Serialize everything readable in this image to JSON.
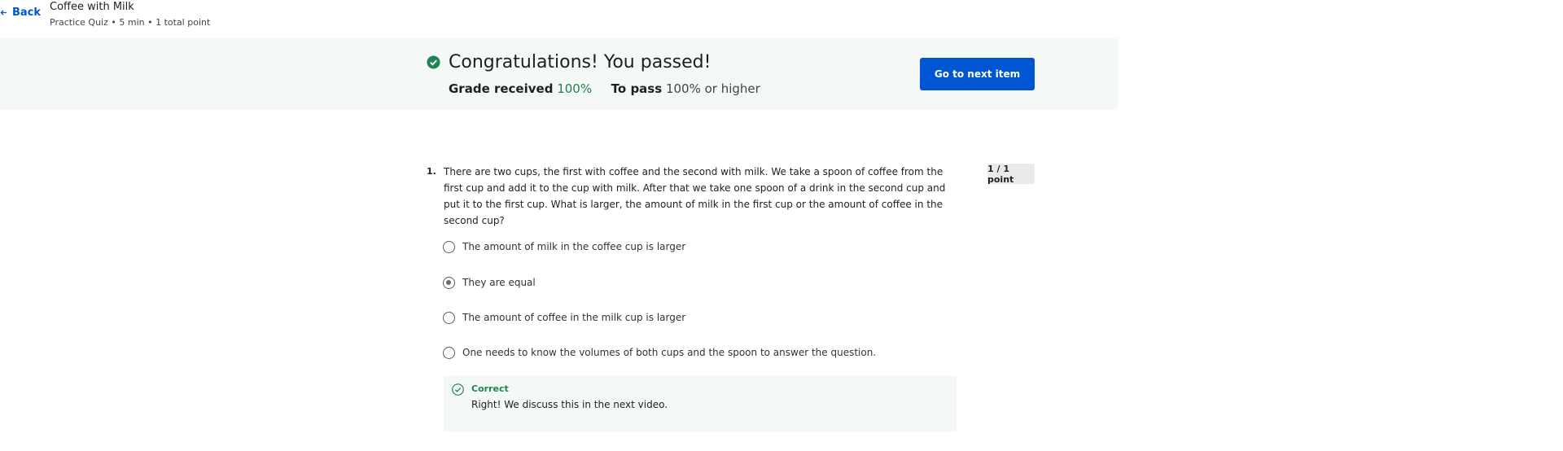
{
  "header": {
    "back_label": "Back",
    "title": "Coffee with Milk",
    "subtitle": "Practice Quiz • 5 min • 1 total point"
  },
  "banner": {
    "headline": "Congratulations! You passed!",
    "grade_label": "Grade received",
    "grade_value": "100%",
    "pass_label": "To pass",
    "pass_value": "100% or higher",
    "next_button": "Go to next item"
  },
  "question": {
    "number": "1.",
    "text": "There are two cups, the first with coffee and the second with milk. We take a spoon of coffee from the first cup and add it to the cup with milk. After that we take one spoon of a drink in the second cup and put it to the first cup. What is larger, the amount of milk in the first cup or the amount of coffee in the second cup?",
    "points": "1 / 1 point",
    "options": [
      {
        "label": "The amount of milk in the coffee cup is larger",
        "selected": false
      },
      {
        "label": "They are equal",
        "selected": true
      },
      {
        "label": "The amount of coffee in the milk cup is larger",
        "selected": false
      },
      {
        "label": "One needs to know the volumes of both cups and the spoon to answer the question.",
        "selected": false
      }
    ],
    "feedback": {
      "status": "Correct",
      "message": "Right! We discuss this in the next video."
    }
  },
  "colors": {
    "accent": "#0056d2",
    "success": "#1f8354",
    "banner_bg": "#f4f8f6"
  },
  "icons": {
    "back": "arrow-left-icon",
    "pass": "check-circle-filled-icon",
    "feedback": "check-circle-outline-icon"
  }
}
